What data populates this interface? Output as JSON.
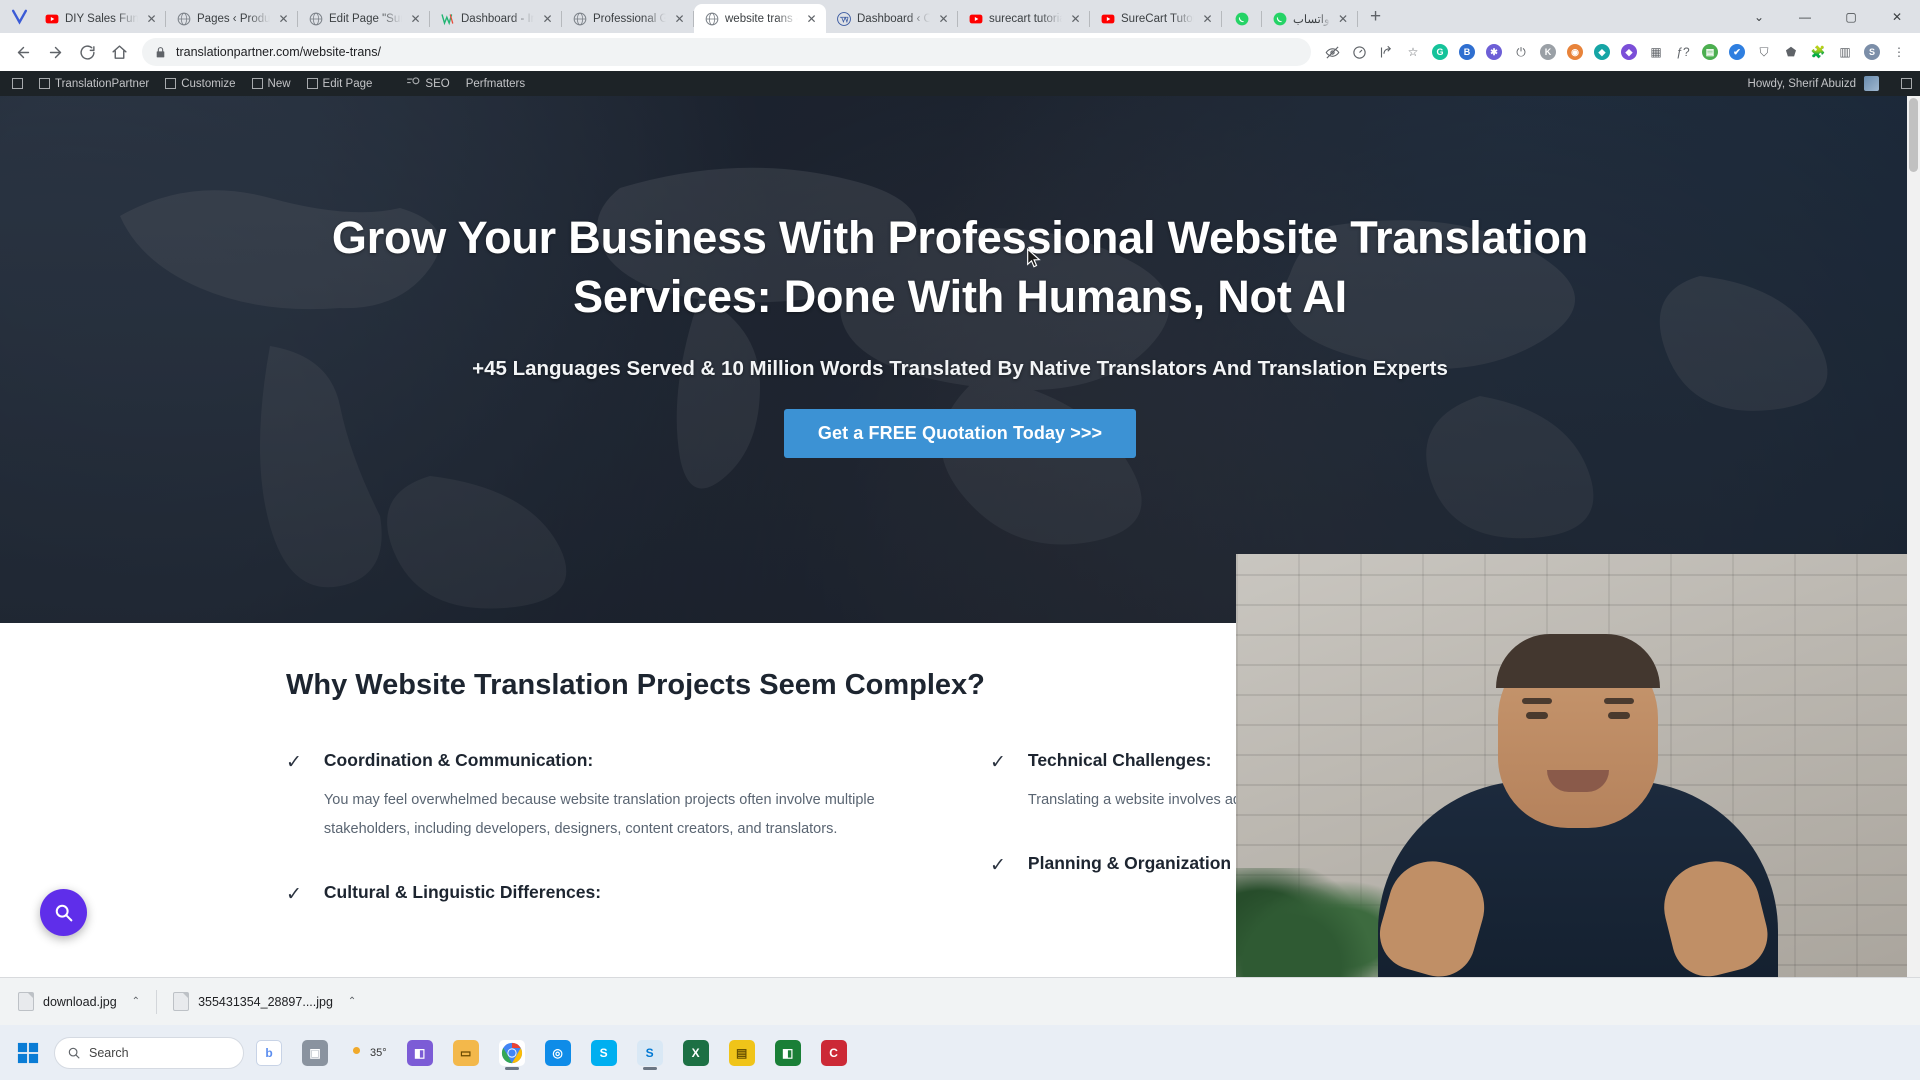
{
  "browser": {
    "tabs": [
      {
        "title": "DIY Sales Funnel #",
        "favicon": "youtube-icon",
        "active": false
      },
      {
        "title": "Pages ‹ Productivi",
        "favicon": "globe-icon",
        "active": false
      },
      {
        "title": "Edit Page \"Survey",
        "favicon": "globe-icon",
        "active": false
      },
      {
        "title": "Dashboard - Insta",
        "favicon": "wealthy-affiliate-icon",
        "active": false
      },
      {
        "title": "Professional Glob",
        "favicon": "globe-icon",
        "active": false
      },
      {
        "title": "website trans - Tra",
        "favicon": "globe-icon",
        "active": true
      },
      {
        "title": "Dashboard ‹ Child",
        "favicon": "wordpress-icon",
        "active": false
      },
      {
        "title": "surecart tutorial -",
        "favicon": "youtube-icon",
        "active": false
      },
      {
        "title": "SureCart Tutorial",
        "favicon": "youtube-icon",
        "active": false
      },
      {
        "title": "",
        "favicon": "whatsapp-icon",
        "active": false
      },
      {
        "title": "واتساب",
        "favicon": "whatsapp-icon",
        "active": false
      }
    ],
    "new_tab_label": "+",
    "window_controls": {
      "minimize": "—",
      "maximize": "▢",
      "close": "✕",
      "more": "⌄"
    },
    "nav": {
      "back": "←",
      "forward": "→",
      "reload": "⟳",
      "home": "⌂"
    },
    "omnibox": {
      "url": "translationpartner.com/website-trans/",
      "lock": "lock-icon"
    },
    "extensions": [
      {
        "name": "eye-slash-icon",
        "glyph": ""
      },
      {
        "name": "speedometer-icon",
        "glyph": ""
      },
      {
        "name": "share-icon",
        "glyph": ""
      },
      {
        "name": "bookmark-star-icon",
        "glyph": "☆"
      },
      {
        "name": "grammarly-icon",
        "glyph": "G",
        "color": "#15c39a"
      },
      {
        "name": "dictionary-icon",
        "glyph": "B",
        "color": "#2f6fd0"
      },
      {
        "name": "gear-sun-icon",
        "glyph": "✱",
        "color": "#6d5fd6"
      },
      {
        "name": "power-icon",
        "glyph": "⏻"
      },
      {
        "name": "k-extension-icon",
        "glyph": "K",
        "color": "#9aa0a6"
      },
      {
        "name": "orange-extension-icon",
        "glyph": "◉",
        "color": "#e8833a"
      },
      {
        "name": "teal-extension-icon",
        "glyph": "◆",
        "color": "#16a5a5"
      },
      {
        "name": "purple-extension-icon",
        "glyph": "◆",
        "color": "#7b4fd8"
      },
      {
        "name": "grid-extension-icon",
        "glyph": "▦"
      },
      {
        "name": "function-icon",
        "glyph": "ƒ?"
      },
      {
        "name": "green-extension-icon",
        "glyph": "▤",
        "color": "#4caf50"
      },
      {
        "name": "blue-check-icon",
        "glyph": "✔",
        "color": "#2f7fe0"
      },
      {
        "name": "shield-icon",
        "glyph": "⛉"
      },
      {
        "name": "tag-icon",
        "glyph": "⬟"
      },
      {
        "name": "puzzle-icon",
        "glyph": "🧩"
      },
      {
        "name": "sidepanel-icon",
        "glyph": "▥"
      },
      {
        "name": "profile-avatar",
        "glyph": "S",
        "color": "#7b8ea8"
      },
      {
        "name": "chrome-menu-icon",
        "glyph": "⋮"
      }
    ]
  },
  "admin_bar": {
    "items": [
      {
        "label": "",
        "icon": "wp-logo-icon"
      },
      {
        "label": "TranslationPartner",
        "icon": "house-icon"
      },
      {
        "label": "Customize",
        "icon": "brush-icon"
      },
      {
        "label": "New",
        "icon": "plus-icon"
      },
      {
        "label": "Edit Page",
        "icon": "pencil-icon"
      },
      {
        "label": "SEO",
        "icon": "seo-icon"
      },
      {
        "label": "Perfmatters",
        "icon": "perfmatters-icon"
      }
    ],
    "howdy": "Howdy, Sherif Abuizd",
    "avatar": "user-avatar"
  },
  "page": {
    "hero": {
      "heading": "Grow Your Business With Professional Website Translation Services: Done With Humans, Not AI",
      "subheading": "+45 Languages Served & 10 Million Words Translated By Native Translators And Translation Experts",
      "cta_label": "Get a FREE Quotation Today >>>",
      "cta_color": "#3c92d4"
    },
    "section": {
      "title": "Why Website Translation Projects Seem Complex?",
      "features_left": [
        {
          "heading": "Coordination & Communication:",
          "body": "You may feel overwhelmed because website translation projects often involve multiple stakeholders, including developers, designers, content creators, and translators."
        },
        {
          "heading": "Cultural & Linguistic Differences:",
          "body": ""
        }
      ],
      "features_right": [
        {
          "heading": "Technical Challenges:",
          "body": "Translating a website involves adapting the website's technical other multimedia elements."
        },
        {
          "heading": "Planning & Organization",
          "body": ""
        }
      ],
      "check_glyph": "✓"
    },
    "floating_button": {
      "name": "search-bubble",
      "color": "#5f2eea"
    }
  },
  "downloads": {
    "items": [
      {
        "name": "download.jpg",
        "caret": "⌃"
      },
      {
        "name": "355431354_28897....jpg",
        "caret": "⌃"
      }
    ]
  },
  "taskbar": {
    "start": "windows-start-icon",
    "search_placeholder": "Search",
    "weather": {
      "temp": "35°",
      "icon": "sun-icon"
    },
    "items": [
      {
        "name": "copilot-icon",
        "glyph": "b",
        "color": "#5b8def"
      },
      {
        "name": "task-view-icon",
        "glyph": "▣",
        "color": "#6b7684"
      },
      {
        "name": "file-explorer-icon",
        "glyph": "📁",
        "color": "#f5b64a"
      },
      {
        "name": "chrome-icon",
        "glyph": "◉",
        "color": "#4285f4"
      },
      {
        "name": "edge-icon",
        "glyph": "◎",
        "color": "#0f8ce8"
      },
      {
        "name": "skype-icon",
        "glyph": "S",
        "color": "#00aff0"
      },
      {
        "name": "skype-business-icon",
        "glyph": "S",
        "color": "#0078d4"
      },
      {
        "name": "excel-icon",
        "glyph": "X",
        "color": "#1d7044"
      },
      {
        "name": "notes-icon",
        "glyph": "▤",
        "color": "#f0c419"
      },
      {
        "name": "outlook-icon",
        "glyph": "◧",
        "color": "#1a7f37"
      },
      {
        "name": "camtasia-icon",
        "glyph": "C",
        "color": "#cc2936"
      }
    ]
  }
}
